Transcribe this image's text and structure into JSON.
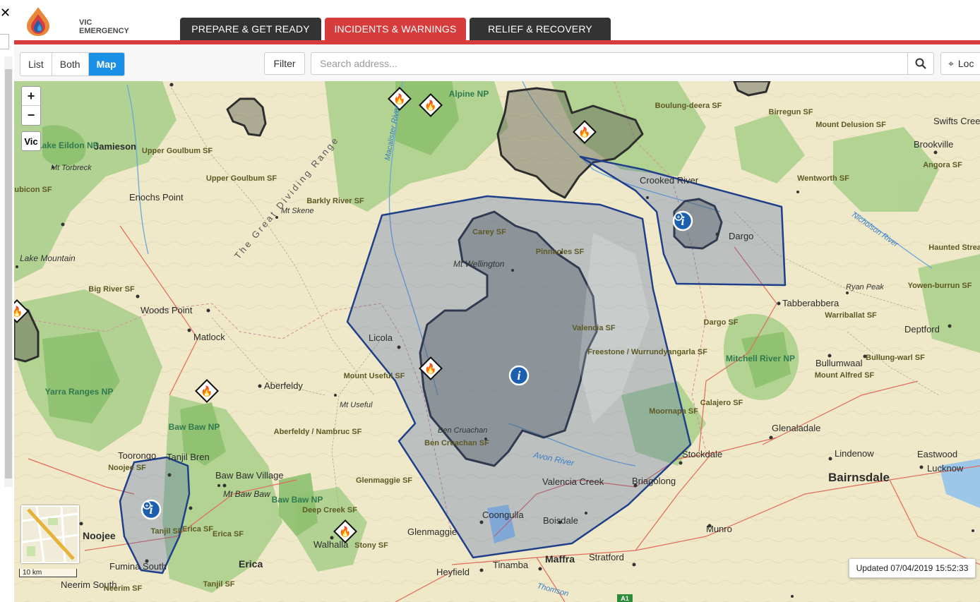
{
  "app": {
    "logo_line1": "VIC",
    "logo_line2": "EMERGENCY"
  },
  "nav": {
    "tabs": [
      {
        "label": "PREPARE & GET READY",
        "active": false
      },
      {
        "label": "INCIDENTS & WARNINGS",
        "active": true
      },
      {
        "label": "RELIEF & RECOVERY",
        "active": false
      }
    ]
  },
  "toolbar": {
    "view_modes": [
      "List",
      "Both",
      "Map"
    ],
    "selected_view": "Map",
    "filter_label": "Filter",
    "search_placeholder": "Search address...",
    "locate_label": "Loc"
  },
  "map": {
    "zoom_in": "+",
    "zoom_out": "−",
    "vic_label": "Vic",
    "scale_label": "10 km",
    "updated_text": "Updated 07/04/2019 15:52:33",
    "colors": {
      "warning_fill": "#3b5ba8",
      "warning_stroke": "#1f3f8a",
      "burnt_fill": "#555555",
      "forest": "#a9cf8a",
      "park": "#8cc06f",
      "river": "#6aa7d8",
      "road": "#e26a5a"
    },
    "places": {
      "jamieson": "Jamieson",
      "woods_point": "Woods Point",
      "matlock": "Matlock",
      "licola": "Licola",
      "aberfeldy": "Aberfeldy",
      "baw_baw_village": "Baw Baw Village",
      "mt_baw_baw": "Mt Baw Baw",
      "noojee": "Noojee",
      "erica": "Erica",
      "walhalla": "Walhalla",
      "heyfield": "Heyfield",
      "tinamba": "Tinamba",
      "maffra": "Maffra",
      "stratford": "Stratford",
      "coongulla": "Coongulla",
      "glenmaggie": "Glenmaggie",
      "boisdale": "Boisdale",
      "briagolong": "Briagolong",
      "valencia_creek": "Valencia Creek",
      "stockdale": "Stockdale",
      "munro": "Munro",
      "bairnsdale": "Bairnsdale",
      "lindenow": "Lindenow",
      "eastwood": "Eastwood",
      "lucknow": "Lucknow",
      "glenaladale": "Glenaladale",
      "bullumwaal": "Bullumwaal",
      "deptford": "Deptford",
      "tabberabbera": "Tabberabbera",
      "dargo": "Dargo",
      "crooked_river": "Crooked River",
      "brookville": "Brookville",
      "swifts_creek": "Swifts Creek",
      "enochs_point": "Enochs Point",
      "tanjil_bren": "Tanjil Bren",
      "toorongo": "Toorongo",
      "fumina_south": "Fumina South",
      "neerim_south": "Neerim South",
      "mt_torbreck": "Mt Torbreck",
      "mt_skene": "Mt Skene",
      "mt_wellington": "Mt Wellington",
      "mt_useful": "Mt Useful",
      "ben_cruachan": "Ben Cruachan",
      "ryan_peak": "Ryan Peak",
      "lake_mountain": "Lake Mountain",
      "alpine_np": "Alpine NP",
      "lake_eildon_np": "Lake Eildon NP",
      "yarra_ranges_np": "Yarra Ranges NP",
      "baw_baw_np": "Baw Baw NP",
      "mitchell_river_np": "Mitchell River NP",
      "great_dividing_range": "The Great Dividing Range",
      "avon_river": "Avon River",
      "nicholson_river": "Nicholson River",
      "macalister_river": "Macalister River",
      "thomson": "Thomson"
    },
    "state_forests": [
      "Upper Goulbum SF",
      "Upper Goulbum SF",
      "Barkly River SF",
      "Big River SF",
      "Carey SF",
      "Pinnacles SF",
      "Valencia SF",
      "Freestone / Wurrundyangarla SF",
      "Moornapa SF",
      "Calajero SF",
      "Mount Useful SF",
      "Aberfeldy / Nambruc SF",
      "Glenmaggie SF",
      "Deep Creek SF",
      "Stony SF",
      "Tanjil SF",
      "Erica SF",
      "Ben Cruachan SF",
      "Dargo SF",
      "Wentworth SF",
      "Angora SF",
      "Birregun SF",
      "Mount Delusion SF",
      "Boulung-deera SF",
      "Warriballat SF",
      "Bullung-warl SF",
      "Mount Alfred SF",
      "Yowen-burrun SF",
      "Noojee SF",
      "Neerim SF",
      "Rubicon SF",
      "Tanjil SF",
      "Erica SF",
      "Haunted Stream SF"
    ]
  }
}
